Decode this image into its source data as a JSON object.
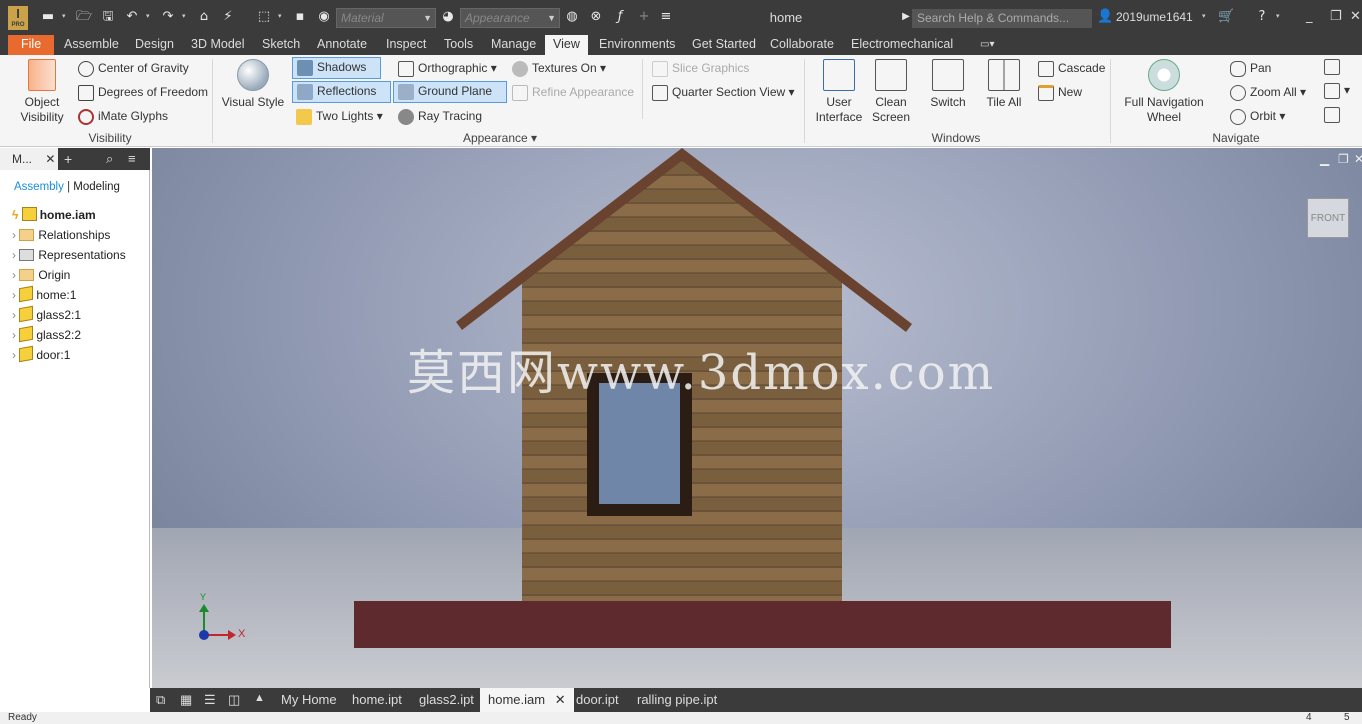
{
  "app": {
    "title": "home",
    "logo_text": "I",
    "logo_sub": "PRO"
  },
  "quick_access": {
    "material_placeholder": "Material",
    "appearance_placeholder": "Appearance",
    "search_placeholder": "Search Help & Commands...",
    "user": "2019ume1641"
  },
  "menu": {
    "file": "File",
    "tabs": [
      "Assemble",
      "Design",
      "3D Model",
      "Sketch",
      "Annotate",
      "Inspect",
      "Tools",
      "Manage",
      "View",
      "Environments",
      "Get Started",
      "Collaborate",
      "Electromechanical"
    ],
    "active": "View"
  },
  "ribbon": {
    "visibility": {
      "object_visibility": "Object\nVisibility",
      "center_of_gravity": "Center of Gravity",
      "degrees_of_freedom": "Degrees of Freedom",
      "imate_glyphs": "iMate Glyphs",
      "label": "Visibility"
    },
    "appearance": {
      "visual_style": "Visual Style",
      "shadows": "Shadows",
      "reflections": "Reflections",
      "two_lights": "Two Lights",
      "orthographic": "Orthographic",
      "ground_plane": "Ground Plane",
      "ray_tracing": "Ray Tracing",
      "textures_on": "Textures On",
      "refine_appearance": "Refine Appearance",
      "slice_graphics": "Slice Graphics",
      "quarter_section_view": "Quarter Section View",
      "label": "Appearance"
    },
    "windows": {
      "user_interface": "User\nInterface",
      "clean_screen": "Clean\nScreen",
      "switch": "Switch",
      "tile_all": "Tile All",
      "cascade": "Cascade",
      "new": "New",
      "label": "Windows"
    },
    "navigate": {
      "full_navigation_wheel": "Full Navigation\nWheel",
      "pan": "Pan",
      "zoom_all": "Zoom All",
      "orbit": "Orbit",
      "label": "Navigate"
    }
  },
  "browser": {
    "tab": "M...",
    "mode_assembly": "Assembly",
    "mode_modeling": "Modeling",
    "root": "home.iam",
    "items": [
      "Relationships",
      "Representations",
      "Origin",
      "home:1",
      "glass2:1",
      "glass2:2",
      "door:1"
    ]
  },
  "viewport": {
    "watermark": "莫西网www.3dmox.com",
    "viewcube_label": "FRONT",
    "axis_x": "X",
    "axis_y": "Y"
  },
  "document_tabs": {
    "my_home": "My Home",
    "tabs": [
      "home.ipt",
      "glass2.ipt",
      "home.iam",
      "door.ipt",
      "ralling pipe.ipt"
    ],
    "active": "home.iam"
  },
  "status": {
    "text": "Ready",
    "right1": "4",
    "right2": "5"
  },
  "colors": {
    "accent_file": "#e86a2e",
    "chrome_dark": "#3b3b3b",
    "selected_fill": "#cde3f7"
  }
}
